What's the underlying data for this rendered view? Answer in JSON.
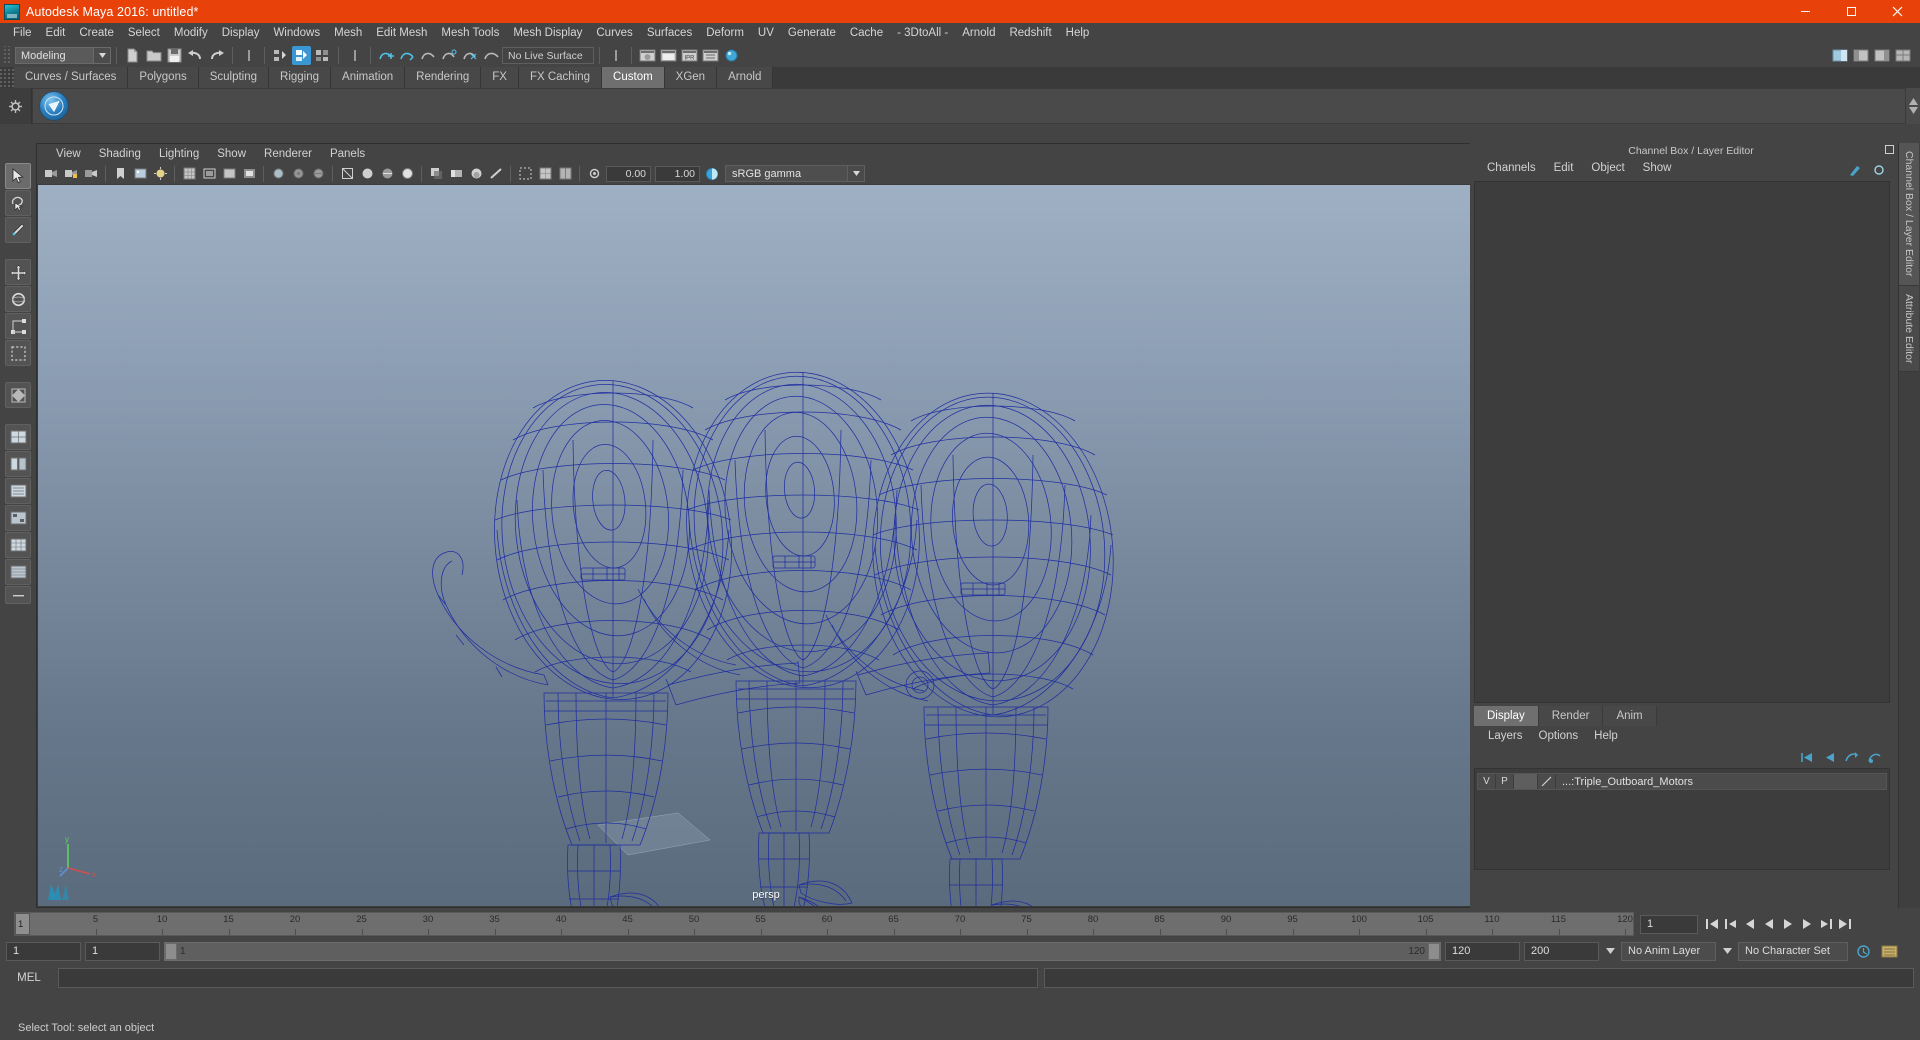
{
  "titlebar": {
    "title": "Autodesk Maya 2016: untitled*",
    "minimize": "minimize-icon",
    "maximize": "maximize-icon",
    "close": "close-icon"
  },
  "menubar": {
    "items": [
      "File",
      "Edit",
      "Create",
      "Select",
      "Modify",
      "Display",
      "Windows",
      "Mesh",
      "Edit Mesh",
      "Mesh Tools",
      "Mesh Display",
      "Curves",
      "Surfaces",
      "Deform",
      "UV",
      "Generate",
      "Cache",
      "- 3DtoAll -",
      "Arnold",
      "Redshift",
      "Help"
    ]
  },
  "toolbar": {
    "mode": "Modeling",
    "live_surface": "No Live Surface",
    "icons": [
      "new-scene-icon",
      "open-scene-icon",
      "save-scene-icon",
      "undo-icon",
      "redo-icon",
      "select-hierarchy-icon",
      "select-object-icon",
      "select-component-icon",
      "snap-curve-icon",
      "snap-grid-icon",
      "snap-point-icon",
      "snap-projected-icon",
      "snap-view-plane-icon",
      "make-live-icon",
      "render-view-icon",
      "render-current-frame-icon",
      "ipr-render-icon",
      "render-settings-icon",
      "hypershade-icon"
    ],
    "right_icons": [
      "attribute-editor-icon",
      "tool-settings-icon",
      "channel-box-icon",
      "modeling-toolkit-icon"
    ]
  },
  "shelf": {
    "tabs": [
      "Curves / Surfaces",
      "Polygons",
      "Sculpting",
      "Rigging",
      "Animation",
      "Rendering",
      "FX",
      "FX Caching",
      "Custom",
      "XGen",
      "Arnold"
    ],
    "selected_tab": "Custom",
    "buttons": [
      "custom-shelf-button"
    ]
  },
  "viewport": {
    "menus": [
      "View",
      "Shading",
      "Lighting",
      "Show",
      "Renderer",
      "Panels"
    ],
    "exposure_value": "0.00",
    "gamma_value": "1.00",
    "color_management": "sRGB gamma",
    "camera_label": "persp",
    "axis": {
      "x": "x",
      "y": "y",
      "z": "z"
    },
    "toolbar_icons": [
      "select-camera-icon",
      "lock-camera-icon",
      "camera-attributes-icon",
      "bookmark-icon",
      "image-plane-icon",
      "two-sided-lighting-icon",
      "grid-toggle-icon",
      "film-gate-icon",
      "resolution-gate-icon",
      "gate-mask-icon",
      "xray-icon",
      "xray-joints-icon",
      "xray-active-components-icon",
      "wireframe-icon",
      "smooth-shade-all-icon",
      "smooth-shade-textured-icon",
      "use-default-material-icon",
      "shadows-icon",
      "motion-blur-icon",
      "ao-icon",
      "aa-icon",
      "isolate-select-icon",
      "grid-display-icon",
      "exposure-icon",
      "gamma-icon",
      "color-management-icon"
    ]
  },
  "toolbox": {
    "tools": [
      "select-tool",
      "lasso-select-tool",
      "paint-select-tool",
      "move-tool",
      "rotate-tool",
      "scale-tool",
      "soft-select-tool",
      "last-tool-used",
      "layout-single-perspective",
      "layout-four-view",
      "layout-persp-outliner",
      "layout-persp-graph",
      "layout-hypershade",
      "layout-persp-ue",
      "layout-more"
    ],
    "selected": "select-tool"
  },
  "channel_box": {
    "panel_title": "Channel Box / Layer Editor",
    "menus": [
      "Channels",
      "Edit",
      "Object",
      "Show"
    ],
    "channels": [],
    "dock_buttons": [
      "float-panel-icon",
      "close-panel-icon"
    ]
  },
  "layer_editor": {
    "tabs": [
      "Display",
      "Render",
      "Anim"
    ],
    "selected_tab": "Display",
    "menus": [
      "Layers",
      "Options",
      "Help"
    ],
    "tool_icons": [
      "move-layer-up-icon",
      "move-layer-down-icon",
      "new-layer-icon",
      "new-layer-from-selection-icon"
    ],
    "columns": [
      "V",
      "P"
    ],
    "layers": [
      {
        "visible": "V",
        "playback": "P",
        "color": "#5e5e5e",
        "name": "...:Triple_Outboard_Motors"
      }
    ]
  },
  "vertical_tabs": [
    {
      "label": "Channel Box / Layer Editor",
      "selected": true
    },
    {
      "label": "Attribute Editor",
      "selected": false
    }
  ],
  "time_slider": {
    "start_label": "1",
    "current_frame": "1",
    "ticks": [
      5,
      10,
      15,
      20,
      25,
      30,
      35,
      40,
      45,
      50,
      55,
      60,
      65,
      70,
      75,
      80,
      85,
      90,
      95,
      100,
      105,
      110,
      115,
      120
    ],
    "frame_field": "1",
    "playback_buttons": [
      "go-to-start-icon",
      "step-back-keyframe-icon",
      "step-back-frame-icon",
      "play-backwards-icon",
      "play-forwards-icon",
      "step-forward-frame-icon",
      "step-forward-keyframe-icon",
      "go-to-end-icon"
    ]
  },
  "range_slider": {
    "anim_start": "1",
    "range_start": "1",
    "bar_start_label": "1",
    "bar_end_label": "120",
    "range_end": "120",
    "anim_end": "200",
    "anim_layer": "No Anim Layer",
    "character_set": "No Character Set",
    "auto_key": "auto-keyframe-icon",
    "anim_prefs": "animation-preferences-icon"
  },
  "command_line": {
    "label": "MEL",
    "input_value": "",
    "output_value": ""
  },
  "help_line": {
    "text": "Select Tool: select an object"
  },
  "colors": {
    "title_bar": "#e8410a",
    "app_bg": "#444444",
    "panel_bg": "#3d3d3d",
    "accent_active": "#3b96d4",
    "wireframe": "#1a2a9c",
    "viewport_sky_top": "#9fb0c4",
    "viewport_sky_bottom": "#5a6b7d"
  },
  "scene": {
    "model_name": "Triple_Outboard_Motors",
    "display_mode": "wireframe",
    "object_count": 3
  }
}
